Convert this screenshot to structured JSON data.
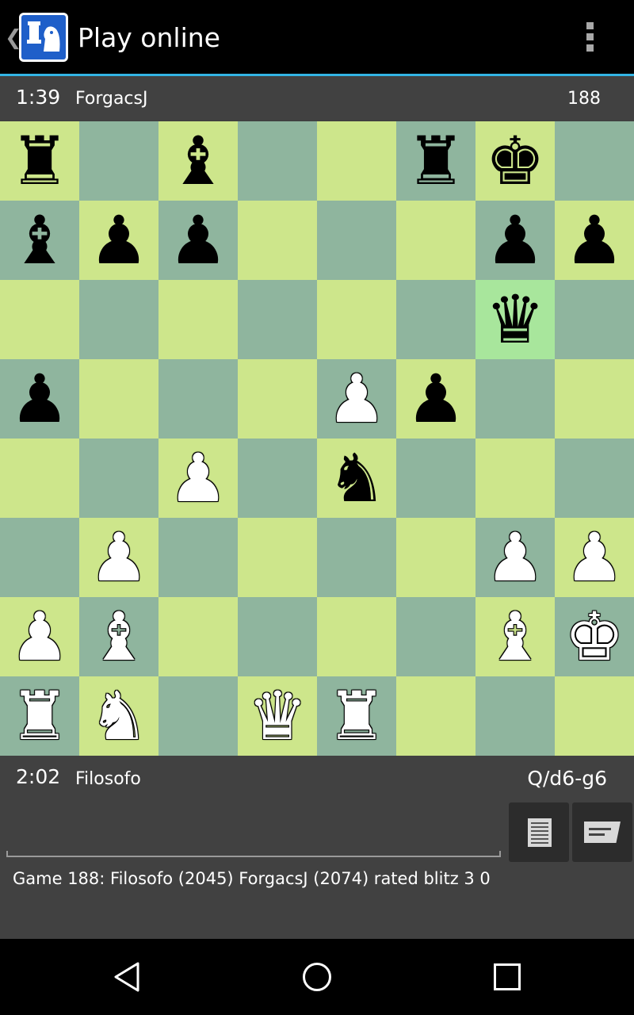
{
  "app": {
    "title": "Play online"
  },
  "icons": {
    "back": "back-caret-icon",
    "app": "chess-rook-knight-icon",
    "overflow": "overflow-menu-icon",
    "moves": "move-list-icon",
    "chat": "chat-message-icon"
  },
  "top_player": {
    "clock": "1:39",
    "name": "ForgacsJ",
    "game_number": "188"
  },
  "bottom_player": {
    "clock": "2:02",
    "name": "Filosofo",
    "last_move": "Q/d6-g6"
  },
  "board": {
    "colors": {
      "light": "#cde68b",
      "dark": "#8fb59e",
      "highlight": "#a8e69c"
    },
    "highlight": [
      "g6"
    ],
    "rows": [
      [
        "r",
        "",
        "b",
        "",
        "",
        "r",
        "k",
        ""
      ],
      [
        "b",
        "p",
        "p",
        "",
        "",
        "",
        "p",
        "p"
      ],
      [
        "",
        "",
        "",
        "",
        "",
        "",
        "q",
        ""
      ],
      [
        "p",
        "",
        "",
        "",
        "P",
        "p",
        "",
        ""
      ],
      [
        "",
        "",
        "P",
        "",
        "n",
        "",
        "",
        ""
      ],
      [
        "",
        "P",
        "",
        "",
        "",
        "",
        "P",
        "P"
      ],
      [
        "P",
        "B",
        "",
        "",
        "",
        "",
        "B",
        "K"
      ],
      [
        "R",
        "N",
        "",
        "Q",
        "R",
        "",
        "",
        ""
      ]
    ]
  },
  "status": "Game 188: Filosofo (2045) ForgacsJ (2074) rated blitz 3 0",
  "navbar": {
    "back": "nav-back-icon",
    "home": "nav-home-icon",
    "recent": "nav-recents-icon"
  }
}
